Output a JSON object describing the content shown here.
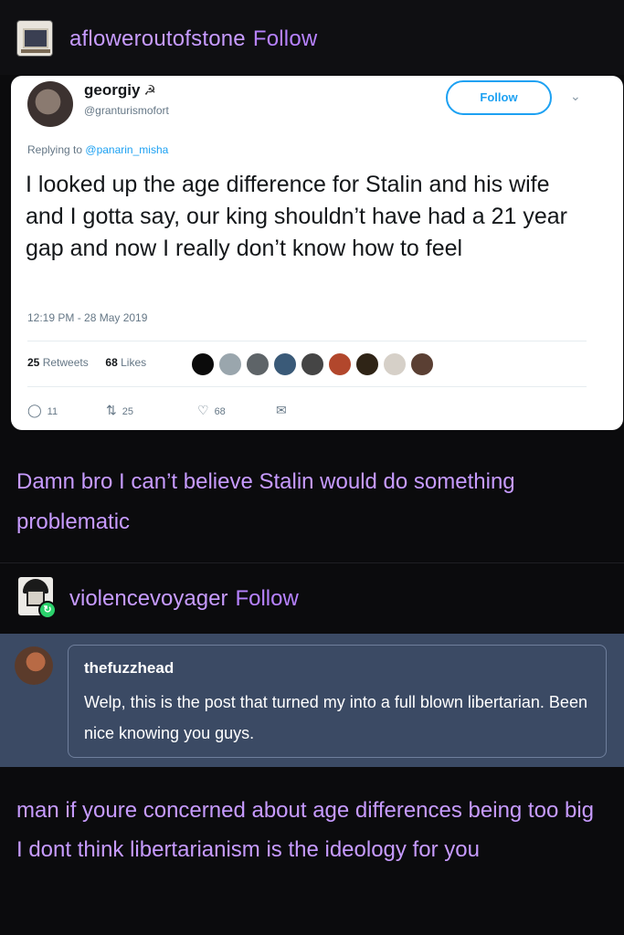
{
  "post1": {
    "username": "afloweroutofstone",
    "follow_label": "Follow"
  },
  "tweet": {
    "name": "georgiy",
    "flag_glyph": "☭",
    "handle": "@granturismofort",
    "follow_button": "Follow",
    "reply_prefix": "Replying to",
    "reply_mention": "@panarin_misha",
    "text": "I looked up the age difference for Stalin and his wife and I gotta say, our king shouldn’t have had a 21 year gap and now I really don’t know how to feel",
    "timestamp": "12:19 PM - 28 May 2019",
    "retweets_count": "25",
    "retweets_label": "Retweets",
    "likes_count": "68",
    "likes_label": "Likes",
    "actions": {
      "replies": "11",
      "retweets": "25",
      "likes": "68"
    },
    "face_colors": [
      "#0b0b0b",
      "#9aa6ad",
      "#5e6468",
      "#3a5a78",
      "#454545",
      "#b2472c",
      "#2f2416",
      "#d6d0c8",
      "#5a3f33"
    ]
  },
  "caption1": "Damn bro I can’t believe Stalin would do something problematic",
  "post2": {
    "username": "violencevoyager",
    "follow_label": "Follow"
  },
  "quote": {
    "name": "thefuzzhead",
    "text": "Welp, this is the post that turned my into a full blown libertarian. Been nice knowing you guys."
  },
  "caption2": "man if youre concerned about age differences being too big I dont think libertarianism is the ideology for you",
  "colors": {
    "accent_purple": "#c79bff",
    "twitter_blue": "#1da1f2",
    "quote_bg": "#3b4a64",
    "reblog_green": "#2bd16b"
  }
}
